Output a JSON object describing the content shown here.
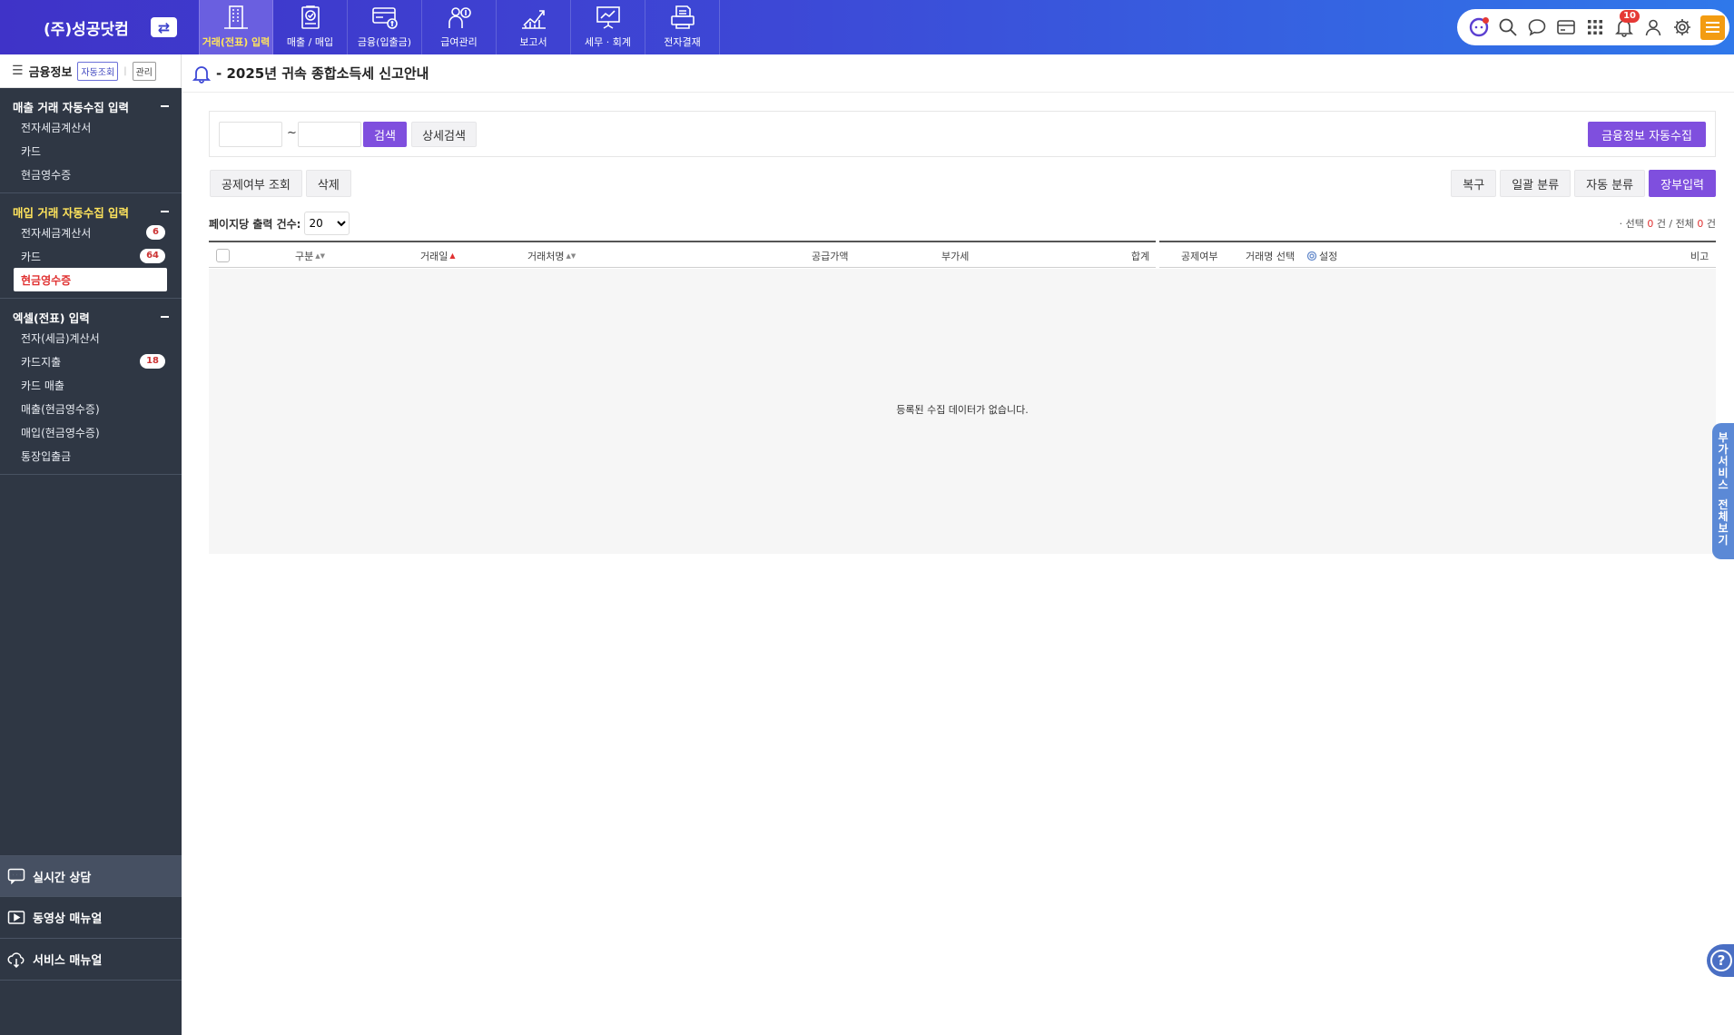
{
  "brand": {
    "name": "(주)성공닷컴",
    "swap_icon": "swap-icon"
  },
  "nav": [
    {
      "label": "거래(전표) 입력",
      "icon": "building-icon",
      "active": true
    },
    {
      "label": "매출 / 매입",
      "icon": "clipboard-check-icon"
    },
    {
      "label": "금융(입출금)",
      "icon": "card-money-icon"
    },
    {
      "label": "급여관리",
      "icon": "person-coin-icon"
    },
    {
      "label": "보고서",
      "icon": "chart-up-icon"
    },
    {
      "label": "세무 · 회계",
      "icon": "presentation-icon"
    },
    {
      "label": "전자결재",
      "icon": "printer-doc-icon"
    }
  ],
  "utility": {
    "notifications": "10"
  },
  "sidebar": {
    "header": {
      "title": "금융정보",
      "chip_auto": "자동조회",
      "chip_manage": "관리"
    },
    "sections": [
      {
        "title": "매출 거래 자동수집 입력",
        "items": [
          {
            "label": "전자세금계산서",
            "count": ""
          },
          {
            "label": "카드",
            "count": ""
          },
          {
            "label": "현금영수증",
            "count": ""
          }
        ]
      },
      {
        "title": "매입 거래 자동수집 입력",
        "items": [
          {
            "label": "전자세금계산서",
            "count": "6"
          },
          {
            "label": "카드",
            "count": "64"
          },
          {
            "label": "현금영수증",
            "count": ""
          }
        ]
      },
      {
        "title": "엑셀(전표) 입력",
        "items": [
          {
            "label": "전자(세금)계산서",
            "count": ""
          },
          {
            "label": "카드지출",
            "count": "18"
          },
          {
            "label": "카드 매출",
            "count": ""
          },
          {
            "label": "매출(현금영수증)",
            "count": ""
          },
          {
            "label": "매입(현금영수증)",
            "count": ""
          },
          {
            "label": "통장입출금",
            "count": ""
          }
        ]
      }
    ],
    "bottom": [
      {
        "label": "실시간 상담",
        "icon": "chat-icon"
      },
      {
        "label": "동영상 매뉴얼",
        "icon": "video-play-icon"
      },
      {
        "label": "서비스 매뉴얼",
        "icon": "cloud-download-icon"
      }
    ]
  },
  "notice": {
    "text": "- 2025년 귀속 종합소득세 신고안내"
  },
  "search": {
    "date_from": "",
    "date_to": "",
    "tilde": "~",
    "search_label": "검색",
    "detail_label": "상세검색",
    "auto_collect_label": "금융정보 자동수집"
  },
  "toolbar": {
    "left": [
      "공제여부 조회",
      "삭제"
    ],
    "right": [
      "복구",
      "일괄 분류",
      "자동 분류",
      "장부입력"
    ]
  },
  "list": {
    "perpage_label": "페이지당 출력 건수:",
    "perpage_value": "20",
    "counts": {
      "prefix": "· 선택",
      "selected": "0",
      "mid": "건 / 전체",
      "total": "0",
      "suffix": "건"
    },
    "columns_left": [
      "구분",
      "거래일",
      "거래처명",
      "공급가액",
      "부가세",
      "합계"
    ],
    "columns_right": [
      "공제여부",
      "거래명 선택",
      "설정",
      "비고"
    ],
    "empty_message": "등록된 수집 데이터가 없습니다."
  },
  "side_tab": {
    "text": [
      "부",
      "가",
      "서",
      "비",
      "스",
      "",
      "전",
      "체",
      "보",
      "기"
    ]
  },
  "colors": {
    "accent": "#7f4fde",
    "topbar": "#3d48d6",
    "sidebar": "#2f3744",
    "highlight_yellow": "#ffe45c"
  }
}
